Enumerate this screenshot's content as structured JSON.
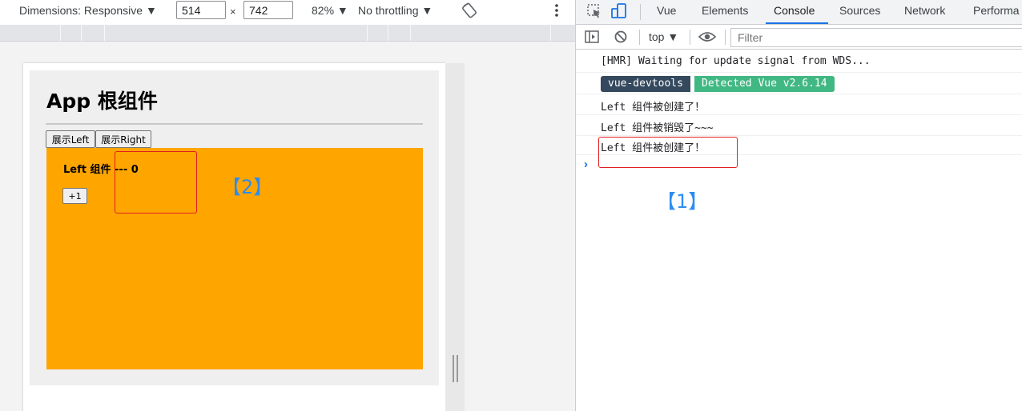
{
  "device_toolbar": {
    "dimensions_label": "Dimensions: Responsive ▼",
    "width_value": "514",
    "times": "×",
    "height_value": "742",
    "zoom_label": "82% ▼",
    "throttle_label": "No throttling ▼",
    "rotate_icon": "rotate-icon",
    "more_icon": "more-vertical-icon"
  },
  "app": {
    "title": "App 根组件",
    "buttons": {
      "show_left": "展示Left",
      "show_right": "展示Right"
    },
    "left_component": {
      "title": "Left 组件 --- 0",
      "plus_button": "+1"
    },
    "annotation_2": "【2】",
    "colors": {
      "orange": "#ffa500",
      "annotation": "#2d8cf0",
      "highlight": "#e02020"
    }
  },
  "devtools": {
    "tabs": [
      "Vue",
      "Elements",
      "Console",
      "Sources",
      "Network",
      "Performa"
    ],
    "active_tab": "Console",
    "console_toolbar": {
      "context": "top ▼",
      "filter_placeholder": "Filter"
    },
    "console_lines": [
      "[HMR] Waiting for update signal from WDS...",
      "Left 组件被创建了！",
      "Left 组件被销毁了~~~",
      "Left 组件被创建了！"
    ],
    "badge": {
      "left": "vue-devtools",
      "right": "Detected Vue v2.6.14"
    },
    "annotation_1": "【1】"
  }
}
